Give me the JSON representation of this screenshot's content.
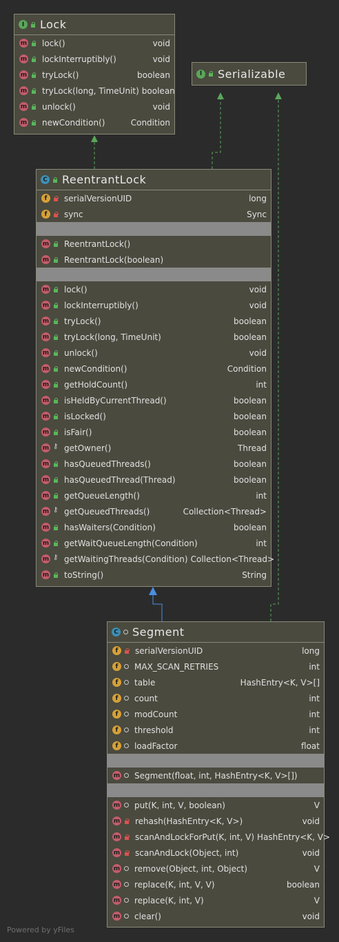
{
  "classes": {
    "lock": {
      "title": "Lock",
      "kind": "I",
      "methods": [
        {
          "name": "lockInterruptibly()",
          "type": "void"
        },
        {
          "name": "tryLock()",
          "type": "boolean"
        },
        {
          "name": "tryLock(long, TimeUnit)",
          "type": "boolean"
        },
        {
          "name": "unlock()",
          "type": "void"
        },
        {
          "name": "newCondition()",
          "type": "Condition"
        }
      ],
      "first_method": {
        "name": "lock()",
        "type": "void"
      }
    },
    "serializable": {
      "title": "Serializable",
      "kind": "I"
    },
    "reentrant": {
      "title": "ReentrantLock",
      "kind": "C",
      "fields": [
        {
          "name": "serialVersionUID",
          "type": "long"
        },
        {
          "name": "sync",
          "type": "Sync"
        }
      ],
      "constructors": [
        {
          "name": "ReentrantLock()"
        },
        {
          "name": "ReentrantLock(boolean)"
        }
      ],
      "methods": [
        {
          "name": "lock()",
          "type": "void"
        },
        {
          "name": "lockInterruptibly()",
          "type": "void"
        },
        {
          "name": "tryLock()",
          "type": "boolean"
        },
        {
          "name": "tryLock(long, TimeUnit)",
          "type": "boolean"
        },
        {
          "name": "unlock()",
          "type": "void"
        },
        {
          "name": "newCondition()",
          "type": "Condition"
        },
        {
          "name": "getHoldCount()",
          "type": "int"
        },
        {
          "name": "isHeldByCurrentThread()",
          "type": "boolean"
        },
        {
          "name": "isLocked()",
          "type": "boolean"
        },
        {
          "name": "isFair()",
          "type": "boolean"
        },
        {
          "name": "getOwner()",
          "type": "Thread"
        },
        {
          "name": "hasQueuedThreads()",
          "type": "boolean"
        },
        {
          "name": "hasQueuedThread(Thread)",
          "type": "boolean"
        },
        {
          "name": "getQueueLength()",
          "type": "int"
        },
        {
          "name": "getQueuedThreads()",
          "type": "Collection<Thread>"
        },
        {
          "name": "hasWaiters(Condition)",
          "type": "boolean"
        },
        {
          "name": "getWaitQueueLength(Condition)",
          "type": "int"
        },
        {
          "name": "getWaitingThreads(Condition)",
          "type": "Collection<Thread>"
        },
        {
          "name": "toString()",
          "type": "String"
        }
      ]
    },
    "segment": {
      "title": "Segment",
      "kind": "C",
      "fields": [
        {
          "name": "serialVersionUID",
          "type": "long"
        },
        {
          "name": "MAX_SCAN_RETRIES",
          "type": "int"
        },
        {
          "name": "table",
          "type": "HashEntry<K, V>[]"
        },
        {
          "name": "count",
          "type": "int"
        },
        {
          "name": "modCount",
          "type": "int"
        },
        {
          "name": "threshold",
          "type": "int"
        },
        {
          "name": "loadFactor",
          "type": "float"
        }
      ],
      "constructors": [
        {
          "name": "Segment(float, int, HashEntry<K, V>[])"
        }
      ],
      "methods": [
        {
          "name": "put(K, int, V, boolean)",
          "type": "V"
        },
        {
          "name": "rehash(HashEntry<K, V>)",
          "type": "void"
        },
        {
          "name": "scanAndLockForPut(K, int, V)",
          "type": "HashEntry<K, V>"
        },
        {
          "name": "scanAndLock(Object, int)",
          "type": "void"
        },
        {
          "name": "remove(Object, int, Object)",
          "type": "V"
        },
        {
          "name": "replace(K, int, V, V)",
          "type": "boolean"
        },
        {
          "name": "replace(K, int, V)",
          "type": "V"
        },
        {
          "name": "clear()",
          "type": "void"
        }
      ]
    }
  },
  "footer": "Powered by yFiles",
  "colors": {
    "background": "#2b2b2b",
    "node_fill": "#4a4a3f",
    "separator": "#8a8a8a",
    "implements_edge": "#5aa65a",
    "extends_edge": "#4a8fe0"
  }
}
